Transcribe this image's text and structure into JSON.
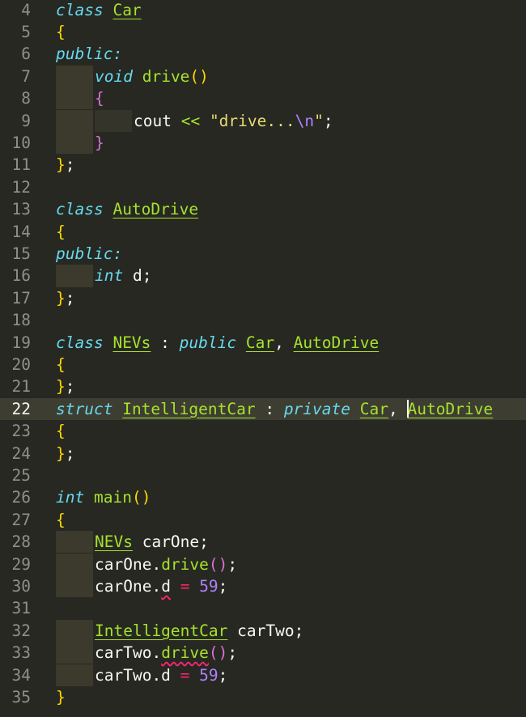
{
  "editor": {
    "current_line": 22,
    "lines": [
      {
        "num": 4,
        "indent": 0,
        "tokens": [
          [
            "storage",
            "class"
          ],
          [
            "plain",
            " "
          ],
          [
            "type",
            "Car"
          ]
        ]
      },
      {
        "num": 5,
        "indent": 0,
        "tokens": [
          [
            "brace",
            "{"
          ]
        ]
      },
      {
        "num": 6,
        "indent": 0,
        "tokens": [
          [
            "storage",
            "public:"
          ]
        ]
      },
      {
        "num": 7,
        "indent": 1,
        "tokens": [
          [
            "storage",
            "void"
          ],
          [
            "plain",
            " "
          ],
          [
            "func",
            "drive"
          ],
          [
            "brace",
            "()"
          ]
        ]
      },
      {
        "num": 8,
        "indent": 1,
        "tokens": [
          [
            "paren",
            "{"
          ]
        ]
      },
      {
        "num": 9,
        "indent": 2,
        "tokens": [
          [
            "plain",
            "cout "
          ],
          [
            "func",
            "<<"
          ],
          [
            "plain",
            " "
          ],
          [
            "str",
            "\"drive..."
          ],
          [
            "esc",
            "\\n"
          ],
          [
            "str",
            "\""
          ],
          [
            "punct",
            ";"
          ]
        ]
      },
      {
        "num": 10,
        "indent": 1,
        "tokens": [
          [
            "paren",
            "}"
          ]
        ]
      },
      {
        "num": 11,
        "indent": 0,
        "tokens": [
          [
            "brace",
            "}"
          ],
          [
            "punct",
            ";"
          ]
        ]
      },
      {
        "num": 12,
        "indent": 0,
        "tokens": []
      },
      {
        "num": 13,
        "indent": 0,
        "tokens": [
          [
            "storage",
            "class"
          ],
          [
            "plain",
            " "
          ],
          [
            "type",
            "AutoDrive"
          ]
        ]
      },
      {
        "num": 14,
        "indent": 0,
        "tokens": [
          [
            "brace",
            "{"
          ]
        ]
      },
      {
        "num": 15,
        "indent": 0,
        "tokens": [
          [
            "storage",
            "public:"
          ]
        ]
      },
      {
        "num": 16,
        "indent": 1,
        "tokens": [
          [
            "storage",
            "int"
          ],
          [
            "plain",
            " d"
          ],
          [
            "punct",
            ";"
          ]
        ]
      },
      {
        "num": 17,
        "indent": 0,
        "tokens": [
          [
            "brace",
            "}"
          ],
          [
            "punct",
            ";"
          ]
        ]
      },
      {
        "num": 18,
        "indent": 0,
        "tokens": []
      },
      {
        "num": 19,
        "indent": 0,
        "tokens": [
          [
            "storage",
            "class"
          ],
          [
            "plain",
            " "
          ],
          [
            "type",
            "NEVs"
          ],
          [
            "plain",
            " : "
          ],
          [
            "storage",
            "public"
          ],
          [
            "plain",
            " "
          ],
          [
            "type",
            "Car"
          ],
          [
            "punct",
            ", "
          ],
          [
            "type",
            "AutoDrive"
          ]
        ]
      },
      {
        "num": 20,
        "indent": 0,
        "tokens": [
          [
            "brace",
            "{"
          ]
        ]
      },
      {
        "num": 21,
        "indent": 0,
        "tokens": [
          [
            "brace",
            "}"
          ],
          [
            "punct",
            ";"
          ]
        ]
      },
      {
        "num": 22,
        "indent": 0,
        "tokens": [
          [
            "storage",
            "struct"
          ],
          [
            "plain",
            " "
          ],
          [
            "type",
            "IntelligentCar"
          ],
          [
            "plain",
            " : "
          ],
          [
            "storage",
            "private"
          ],
          [
            "plain",
            " "
          ],
          [
            "type",
            "Car"
          ],
          [
            "punct",
            ", "
          ],
          [
            "caret",
            ""
          ],
          [
            "type",
            "AutoDrive"
          ]
        ]
      },
      {
        "num": 23,
        "indent": 0,
        "tokens": [
          [
            "brace",
            "{"
          ]
        ]
      },
      {
        "num": 24,
        "indent": 0,
        "tokens": [
          [
            "brace",
            "}"
          ],
          [
            "punct",
            ";"
          ]
        ]
      },
      {
        "num": 25,
        "indent": 0,
        "tokens": []
      },
      {
        "num": 26,
        "indent": 0,
        "tokens": [
          [
            "storage",
            "int"
          ],
          [
            "plain",
            " "
          ],
          [
            "func",
            "main"
          ],
          [
            "brace",
            "()"
          ]
        ]
      },
      {
        "num": 27,
        "indent": 0,
        "tokens": [
          [
            "brace",
            "{"
          ]
        ]
      },
      {
        "num": 28,
        "indent": 1,
        "tokens": [
          [
            "type",
            "NEVs"
          ],
          [
            "plain",
            " carOne"
          ],
          [
            "punct",
            ";"
          ]
        ]
      },
      {
        "num": 29,
        "indent": 1,
        "tokens": [
          [
            "plain",
            "carOne."
          ],
          [
            "func",
            "drive"
          ],
          [
            "paren",
            "()"
          ],
          [
            "punct",
            ";"
          ]
        ]
      },
      {
        "num": 30,
        "indent": 1,
        "tokens": [
          [
            "plain",
            "carOne."
          ],
          [
            "err",
            "d"
          ],
          [
            "plain",
            " "
          ],
          [
            "op",
            "="
          ],
          [
            "plain",
            " "
          ],
          [
            "num",
            "59"
          ],
          [
            "punct",
            ";"
          ]
        ]
      },
      {
        "num": 31,
        "indent": 0,
        "tokens": []
      },
      {
        "num": 32,
        "indent": 1,
        "tokens": [
          [
            "type",
            "IntelligentCar"
          ],
          [
            "plain",
            " carTwo"
          ],
          [
            "punct",
            ";"
          ]
        ]
      },
      {
        "num": 33,
        "indent": 1,
        "tokens": [
          [
            "plain",
            "carTwo."
          ],
          [
            "funcerr",
            "drive"
          ],
          [
            "paren",
            "()"
          ],
          [
            "punct",
            ";"
          ]
        ]
      },
      {
        "num": 34,
        "indent": 1,
        "tokens": [
          [
            "plain",
            "carTwo.d "
          ],
          [
            "op",
            "="
          ],
          [
            "plain",
            " "
          ],
          [
            "num",
            "59"
          ],
          [
            "punct",
            ";"
          ]
        ]
      },
      {
        "num": 35,
        "indent": 0,
        "tokens": [
          [
            "brace",
            "}"
          ]
        ]
      }
    ]
  },
  "colors": {
    "background": "#272822",
    "current_line": "#3e3d32",
    "keyword": "#66d9ef",
    "type": "#a6e22e",
    "string": "#e6db74",
    "number": "#ae81ff",
    "operator": "#f92672",
    "brace": "#ffd700",
    "paren": "#da70d6"
  }
}
